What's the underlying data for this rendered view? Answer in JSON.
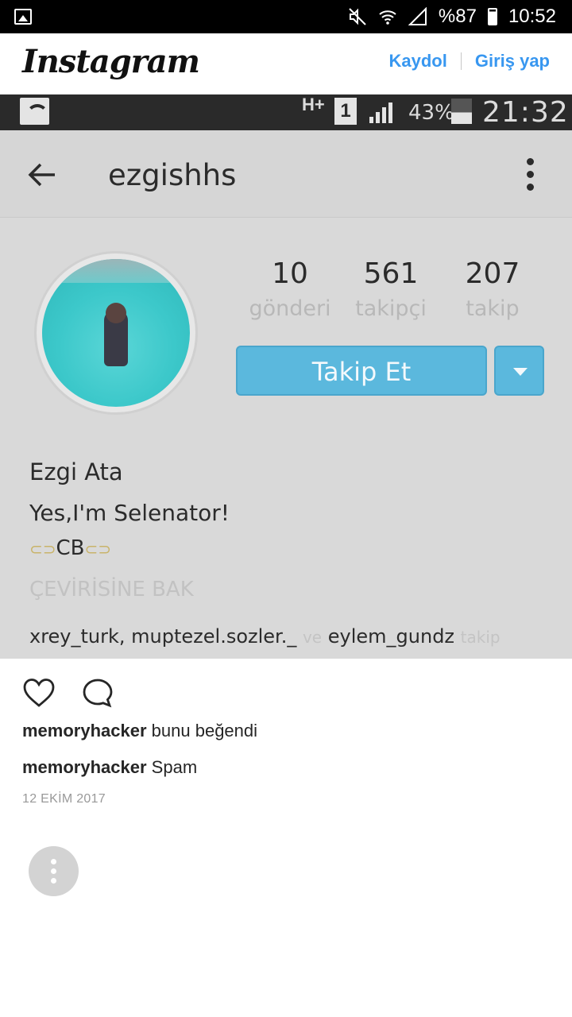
{
  "status_bar": {
    "battery_text": "%87",
    "time": "10:52",
    "icons": [
      "gallery-icon",
      "mute-icon",
      "wifi-icon",
      "signal-icon",
      "battery-icon"
    ]
  },
  "header": {
    "logo": "Instagram",
    "signup_label": "Kaydol",
    "login_label": "Giriş yap"
  },
  "post_image": {
    "inner_status": {
      "network": "H+",
      "sim": "1",
      "battery_pct": "43%",
      "time": "21:32"
    },
    "profile": {
      "username": "ezgishhs",
      "stats": [
        {
          "value": "10",
          "label": "gönderi"
        },
        {
          "value": "561",
          "label": "takipçi"
        },
        {
          "value": "207",
          "label": "takip"
        }
      ],
      "follow_label": "Takip Et",
      "full_name": "Ezgi Ata",
      "bio_line": "Yes,I'm Selenator!",
      "bio_cb": "CB",
      "see_translation": "ÇEVİRİSİNE BAK",
      "followed_by_users": "xrey_turk, muptezel.sozler._",
      "followed_by_conj": "ve",
      "followed_by_last": "eylem_gundz",
      "followed_by_suffix": "takip"
    }
  },
  "post": {
    "likes_user": "memoryhacker",
    "likes_text": "bunu beğendi",
    "comment_user": "memoryhacker",
    "comment_text": "Spam",
    "date": "12 EKİM 2017"
  }
}
